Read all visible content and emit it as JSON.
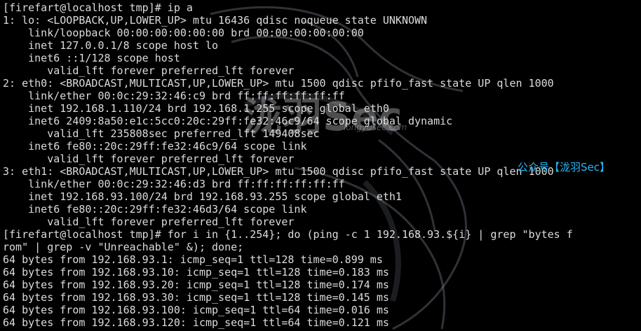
{
  "terminal": {
    "lines": [
      "[firefart@localhost tmp]# ip a",
      "1: lo: <LOOPBACK,UP,LOWER_UP> mtu 16436 qdisc noqueue state UNKNOWN",
      "    link/loopback 00:00:00:00:00:00 brd 00:00:00:00:00:00",
      "    inet 127.0.0.1/8 scope host lo",
      "    inet6 ::1/128 scope host",
      "       valid_lft forever preferred_lft forever",
      "2: eth0: <BROADCAST,MULTICAST,UP,LOWER_UP> mtu 1500 qdisc pfifo_fast state UP qlen 1000",
      "    link/ether 00:0c:29:32:46:c9 brd ff:ff:ff:ff:ff:ff",
      "    inet 192.168.1.110/24 brd 192.168.1.255 scope global eth0",
      "    inet6 2409:8a50:e1c:5cc0:20c:29ff:fe32:46c9/64 scope global dynamic",
      "       valid_lft 235808sec preferred_lft 149408sec",
      "    inet6 fe80::20c:29ff:fe32:46c9/64 scope link",
      "       valid_lft forever preferred_lft forever",
      "3: eth1: <BROADCAST,MULTICAST,UP,LOWER_UP> mtu 1500 qdisc pfifo_fast state UP qlen 1000",
      "    link/ether 00:0c:29:32:46:d3 brd ff:ff:ff:ff:ff:ff",
      "    inet 192.168.93.100/24 brd 192.168.93.255 scope global eth1",
      "    inet6 fe80::20c:29ff:fe32:46d3/64 scope link",
      "       valid_lft forever preferred_lft forever",
      "[firefart@localhost tmp]# for i in {1..254}; do (ping -c 1 192.168.93.${i} | grep \"bytes f",
      "rom\" | grep -v \"Unreachable\" &); done;",
      "64 bytes from 192.168.93.1: icmp_seq=1 ttl=128 time=0.899 ms",
      "64 bytes from 192.168.93.10: icmp_seq=1 ttl=128 time=0.183 ms",
      "64 bytes from 192.168.93.20: icmp_seq=1 ttl=128 time=0.174 ms",
      "64 bytes from 192.168.93.30: icmp_seq=1 ttl=128 time=0.145 ms",
      "64 bytes from 192.168.93.100: icmp_seq=1 ttl=64 time=0.016 ms",
      "64 bytes from 192.168.93.120: icmp_seq=1 ttl=64 time=0.121 ms"
    ]
  },
  "watermark": {
    "logo_text": "泷羽Sec",
    "site_text": "longyusec.com",
    "channel_text": "公众号【泷羽Sec】"
  },
  "colors": {
    "background": "#000000",
    "text": "#dcdcdc",
    "channel": "#29b6f6"
  }
}
